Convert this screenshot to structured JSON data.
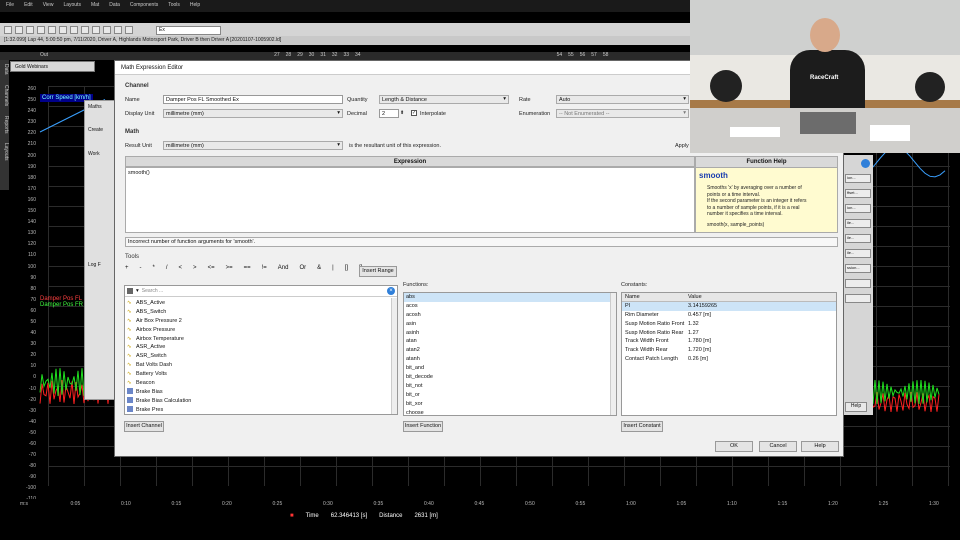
{
  "app": {
    "menu": [
      "File",
      "Edit",
      "View",
      "Layouts",
      "Mat",
      "Data",
      "Components",
      "Tools",
      "Help"
    ],
    "status_line": "[1:32.099] Lap 44, 5:00:50 pm, 7/11/2020, Driver A, Highlands Motorsport Park, Driver B then Driver A [20201107-1005902.ld]",
    "workspace": "Gold Webinars",
    "toolbar_select": "Ex",
    "ruler_labels": [
      "27",
      "28",
      "29",
      "30",
      "31",
      "32",
      "33",
      "34",
      "54",
      "55",
      "56",
      "57",
      "58"
    ],
    "side_tabs": [
      "Data",
      "Channels",
      "Reports",
      "Layouts"
    ],
    "outlap": "Out"
  },
  "chart": {
    "y_ticks": [
      "260",
      "250",
      "240",
      "230",
      "220",
      "210",
      "200",
      "190",
      "180",
      "170",
      "160",
      "150",
      "140",
      "130",
      "120",
      "110",
      "100",
      "90",
      "80",
      "70",
      "60",
      "50",
      "40",
      "30",
      "20",
      "10",
      "0",
      "-10",
      "-20",
      "-30",
      "-40",
      "-50",
      "-60",
      "-70",
      "-80",
      "-90",
      "-100",
      "-110"
    ],
    "legend_top": "Corr Speed [km/h]",
    "legend_bottom": [
      "Damper Pos FL",
      "Damper Pos FR"
    ],
    "x_ticks": [
      "m:s",
      "0:05",
      "0:10",
      "0:15",
      "0:20",
      "0:25",
      "0:30",
      "0:35",
      "0:40",
      "0:45",
      "0:50",
      "0:55",
      "1:00",
      "1:05",
      "1:10",
      "1:15",
      "1:20",
      "1:25",
      "1:30"
    ],
    "time_label": "Time",
    "time_value": "62.346413 [s]",
    "distance_label": "Distance",
    "distance_value": "2631 [m]"
  },
  "maths": {
    "title": "Maths",
    "create": "Create",
    "work": "Work",
    "log": "Log F"
  },
  "right_panel": {
    "buttons": [
      "ion...",
      "ffset...",
      "ion...",
      "ile...",
      "ile...",
      "ile...",
      "ssion...",
      "",
      ""
    ],
    "help": "Help"
  },
  "dialog": {
    "title": "Math Expression Editor",
    "channel_section": "Channel",
    "name_label": "Name",
    "name_value": "Damper Pos FL Smoothed Ex",
    "quantity_label": "Quantity",
    "quantity_value": "Length & Distance",
    "rate_label": "Rate",
    "rate_value": "Auto",
    "display_unit_label": "Display Unit",
    "display_unit_value": "millimetre (mm)",
    "decimal_label": "Decimal",
    "decimal_value": "2",
    "interpolate_label": "Interpolate",
    "enumeration_label": "Enumeration",
    "enumeration_value": "-- Not Enumerated --",
    "math_section": "Math",
    "result_unit_label": "Result Unit",
    "result_unit_value": "millimetre (mm)",
    "result_unit_note": "is the resultant unit of this expression.",
    "apply": "Apply",
    "expression_header": "Expression",
    "expression_text": "smooth()",
    "function_help_header": "Function Help",
    "fh_name": "smooth",
    "fh_desc": [
      "Smooths 'x' by averaging over a number of",
      "points or a time interval.",
      "If the second parameter is an integer it refers",
      "to a number of sample points, if it is a real",
      "number it specifies a time interval."
    ],
    "fh_sig": "smooth(x, sample_points)",
    "error": "Incorrect number of function arguments for 'smooth'.",
    "tools_section": "Tools",
    "operators": [
      "+",
      "-",
      "*",
      "/",
      "<",
      ">",
      "<=",
      ">=",
      "==",
      "!=",
      "And",
      "Or",
      "&",
      "|",
      "[]",
      "[]"
    ],
    "insert_range": "Insert Range",
    "search_placeholder": "Search ...",
    "channels": [
      "ABS_Active",
      "ABS_Switch",
      "Air Box Pressure 2",
      "Airbox Pressure",
      "Airbox Temperature",
      "ASR_Active",
      "ASR_Switch",
      "Bat Volts Dash",
      "Battery Volts",
      "Beacon",
      "Brake Bias",
      "Brake Bias Calculation",
      "Brake Pres"
    ],
    "functions_label": "Functions:",
    "functions": [
      "abs",
      "acos",
      "acosh",
      "asin",
      "asinh",
      "atan",
      "atan2",
      "atanh",
      "bit_and",
      "bit_decode",
      "bit_not",
      "bit_or",
      "bit_xor",
      "choose"
    ],
    "constants_label": "Constants:",
    "const_headers": [
      "Name",
      "Value"
    ],
    "constants": [
      {
        "name": "PI",
        "value": "3.14159265"
      },
      {
        "name": "Rim Diameter",
        "value": "0.457 [m]"
      },
      {
        "name": "Susp Motion Ratio Front",
        "value": "1.32"
      },
      {
        "name": "Susp Motion Ratio Rear",
        "value": "1.27"
      },
      {
        "name": "Track Width Front",
        "value": "1.780 [m]"
      },
      {
        "name": "Track Width Rear",
        "value": "1.720 [m]"
      },
      {
        "name": "Contact Patch Length",
        "value": "0.26 [m]"
      }
    ],
    "insert_channel": "Insert Channel",
    "insert_function": "Insert Function",
    "insert_constant": "Insert Constant",
    "ok": "OK",
    "cancel": "Cancel",
    "help": "Help"
  },
  "webcam": {
    "logo": "RaceCraft"
  },
  "colors": {
    "accent": "#1a3db0",
    "help_bg": "#fffbd0",
    "speed_line": "#3aa0ff",
    "damper_fl": "#ff2020",
    "damper_fr": "#20e020"
  }
}
